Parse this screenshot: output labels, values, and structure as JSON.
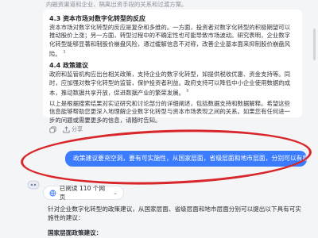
{
  "top_fade_text": "内融资渠道和企业、隔离出资手段的关系和过渡方案。",
  "answer": {
    "section_43_title": "4.3 资本市场对数字化转型的反应",
    "section_43_body": "资本市场对数字化转型的反应是复杂和多维的。一方面，投资者对数字化转型的积极期望可以推动股价上涨；另一方面，转型过程中的不确定性也可能导致市场波动。研究表明，企业数字化转型能够显著和制股价崩盘风险，通过缓解信息不对称，改善企业基本面来抑制股价崩盘风险。",
    "section_43_cite": "3",
    "section_44_title": "4.4 政策建议",
    "section_44_body": "政府和监管机构应出台相关政策，支持企业的数字化转型，如提供税收优惠、资金支持等。同时，应加强对数字化转型的监管，保护投资者利益。政府支持可以降低中小企业使用数据的成本，推动数据共享开放，促进数据产业的繁荣发展。",
    "section_44_cite": "6",
    "closing": "以上是根据搜索结果对实证研究和讨论部分的详细阐述，包括数据支持和数据解释。希望这些信息能够帮助您更深入地理解企业数字化转型与资本市场表现之间的关系。如果您有任何进一步的问题或需要更多的信息，请随时告知。"
  },
  "actions": {
    "share_label": "分享"
  },
  "user_message": "政策建议要充空洞，要有可实施性，从国家层面，省级层面和地市层面，分别可以有哪些建议。",
  "search_pill": {
    "label": "已阅读 110 个网页"
  },
  "reply": {
    "intro": "针对企业数字化转型的政策建议，从国家层面、省级层面和地市层面分别可以提出以下具有可实施性的建议：",
    "heading": "国家层面政策建议："
  }
}
